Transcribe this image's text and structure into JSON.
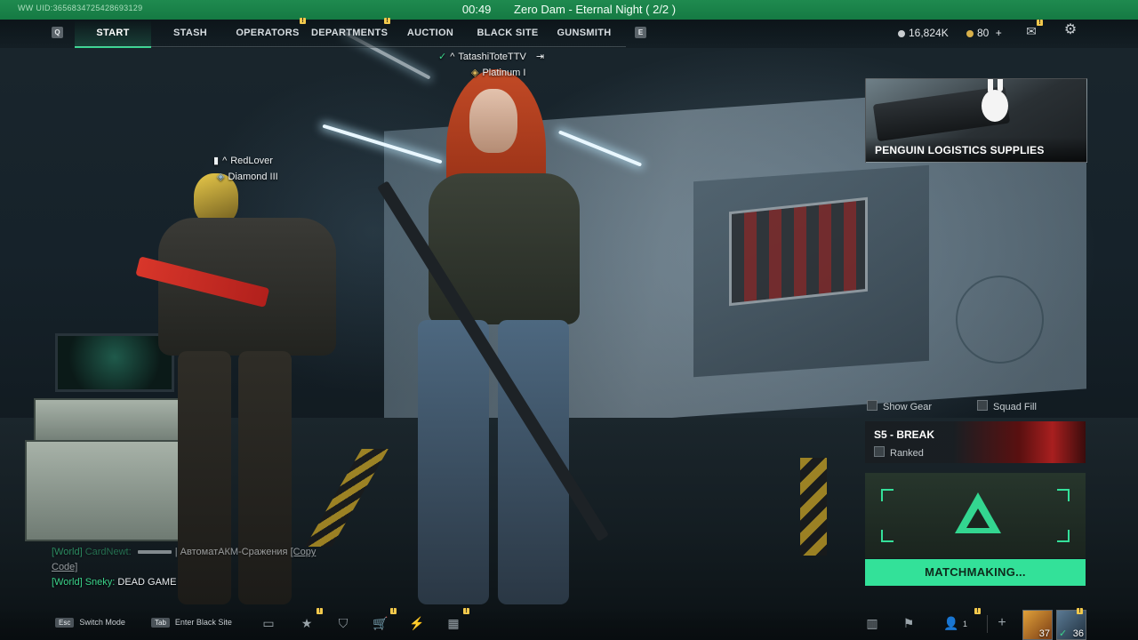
{
  "top": {
    "uid": "WW UID:3656834725428693129",
    "clock": "00:49",
    "session": "Zero Dam - Eternal Night ( 2/2 )"
  },
  "nav": {
    "left_key": "Q",
    "right_key": "E",
    "tabs": [
      "START",
      "STASH",
      "OPERATORS",
      "DEPARTMENTS",
      "AUCTION",
      "BLACK SITE",
      "GUNSMITH"
    ],
    "active_tab": "START"
  },
  "currency": {
    "coins": "16,824K",
    "gold": "80"
  },
  "players": {
    "main": {
      "name": "TatashiToteTTV",
      "rank": "Platinum I"
    },
    "ally": {
      "name": "RedLover",
      "rank": "Diamond III"
    }
  },
  "promo": {
    "title": "PENGUIN LOGISTICS SUPPLIES"
  },
  "toggles": {
    "show_gear": "Show Gear",
    "squad_fill": "Squad Fill"
  },
  "mode": {
    "title": "S5 - BREAK",
    "ranked": "Ranked"
  },
  "matchmaking": {
    "button": "MATCHMAKING..."
  },
  "chat": {
    "lines": [
      {
        "channel": "[World]",
        "name": "CardNewt:",
        "text": "АвтоматАКМ-Сражения",
        "link": "[Copy",
        "cont": "Code]"
      },
      {
        "channel": "[World]",
        "name": "Sneky:",
        "text": "DEAD GAME"
      }
    ]
  },
  "bottom": {
    "hints": [
      {
        "key": "Esc",
        "label": "Switch Mode"
      },
      {
        "key": "Tab",
        "label": "Enter Black Site"
      }
    ],
    "squad_count": "1",
    "avatar_levels": [
      "37",
      "36"
    ]
  },
  "colors": {
    "accent": "#33e199",
    "top_strip": "#1f8a4f",
    "alert": "#f2c94c"
  }
}
